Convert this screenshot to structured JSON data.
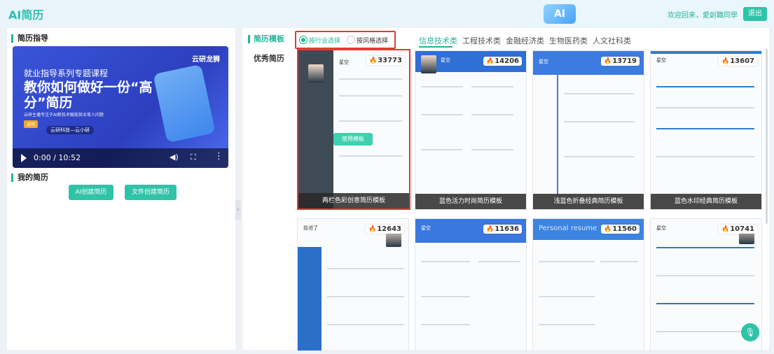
{
  "header": {
    "title": "AI简历",
    "logo_text": "AI",
    "welcome": "欢迎回来，愛創職同學",
    "logout": "退出"
  },
  "left": {
    "guide_title": "简历指导",
    "video": {
      "brand": "云研龙狮",
      "subtitle": "就业指导系列专题课程",
      "title": "教你如何做好一份“高分”简历",
      "desc": "云研主播专注于AI新技术赋能就业育人问题",
      "tag": "讲师",
      "org": "云研科技—云小研",
      "time": "0:00 / 10:52"
    },
    "my_resume_title": "我的简历",
    "btn_ai_create": "AI创建简历",
    "btn_file_create": "文件创建简历"
  },
  "right": {
    "categories": [
      "简历模板",
      "优秀简历"
    ],
    "filter": {
      "by_industry": "按行业选择",
      "by_style": "按风格选择"
    },
    "tabs": [
      "信息技术类",
      "工程技术类",
      "金融经济类",
      "生物医药类",
      "人文社科类"
    ],
    "use_template_label": "使用模板",
    "cards": [
      {
        "name": "两栏色彩创意简历模板",
        "count": "33773",
        "header": "星空",
        "accent": "#3f4a57"
      },
      {
        "name": "蓝色活力时尚简历模板",
        "count": "14206",
        "header": "星空",
        "accent": "#2f6fd6"
      },
      {
        "name": "浅蓝色折叠经典简历模板",
        "count": "13719",
        "header": "星空",
        "accent": "#3d7be0"
      },
      {
        "name": "蓝色水印经典简历模板",
        "count": "13607",
        "header": "星空",
        "accent": "#2a7fd0"
      },
      {
        "name": "",
        "count": "12643",
        "header": "拾进了",
        "accent": "#2c6fc9"
      },
      {
        "name": "",
        "count": "11636",
        "header": "星空",
        "accent": "#3a78e0"
      },
      {
        "name": "",
        "count": "11560",
        "header": "Personal resume",
        "accent": "#3c84e2"
      },
      {
        "name": "",
        "count": "10741",
        "header": "星空",
        "accent": "#2a78d2"
      }
    ]
  }
}
